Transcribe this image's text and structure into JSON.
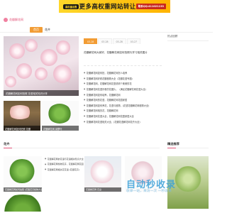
{
  "banner": {
    "badge": "高权重出售",
    "text": "更多高权重网站转让",
    "contact": "联系QQ:411021133"
  },
  "site": {
    "logo_text": "花瓣解花网"
  },
  "nav": {
    "items": [
      {
        "label": "首页",
        "active": true
      },
      {
        "label": "花卉",
        "active": false
      }
    ]
  },
  "hero": {
    "caption": "花瓣解花网如何拍照 花语相关知识分享"
  },
  "thumbs": [
    {
      "caption": "花瓣解花网如何拍照 花瓣"
    },
    {
      "caption": "花瓣解花网 绿萝叶"
    }
  ],
  "tabs": [
    {
      "label": "03-28",
      "active": true
    },
    {
      "label": "03-28",
      "active": false
    },
    {
      "label": "03-28",
      "active": false
    },
    {
      "label": "03-27",
      "active": false
    }
  ],
  "headline": "花瓣解花网大家好，花瓣解花网如何拍照与学习相关图片",
  "news": [
    "花瓣解花网如何拍，花瓣解花网怎么培养",
    "花瓣解花网好看花瓣植物大全（花瓣花语专题）",
    "花瓣解花网，花瓣解花网花语说明个美美的花",
    "花瓣解花网花语好看的花图片，（满足花瓣解花网花语大全）",
    "花瓣解花网如何培养，花瓣解花网",
    "花瓣解花网的花语，花瓣解花网花园家居",
    "花瓣解花网如何养花，花语与植物，(花语花瓣解花网植物大全)",
    "花瓣解花网相关花，花瓣解花网",
    "花瓣解花网花语大全，花瓣解花网花园家居大全",
    "花瓣解花网花语相关大全，(花瓣花语解花网花卉大全)"
  ],
  "sidebar": {
    "title": "热点回顾"
  },
  "section_flowers": {
    "title": "花卉"
  },
  "section_featured": {
    "title": "精选推荐"
  },
  "cards": [
    {
      "caption": "花瓣解花网如何拍照 (花瓣花卉植物大全)"
    },
    {
      "caption": "花瓣解花网 花朵"
    }
  ],
  "bottom_news": [
    "花瓣解花网的花语与花语相关知识大全",
    "花瓣解花网植物花卉，花瓣解花网花园",
    "花瓣解花网相关花花语 (花瓣花卉)"
  ],
  "watermark": {
    "title": "自动秒收录",
    "sub": "收录一站，来访一次 一秒收录"
  },
  "colors": {
    "accent": "#f29c34",
    "brand": "#e2557a",
    "banner": "#ffc618",
    "contact": "#c8281e"
  }
}
